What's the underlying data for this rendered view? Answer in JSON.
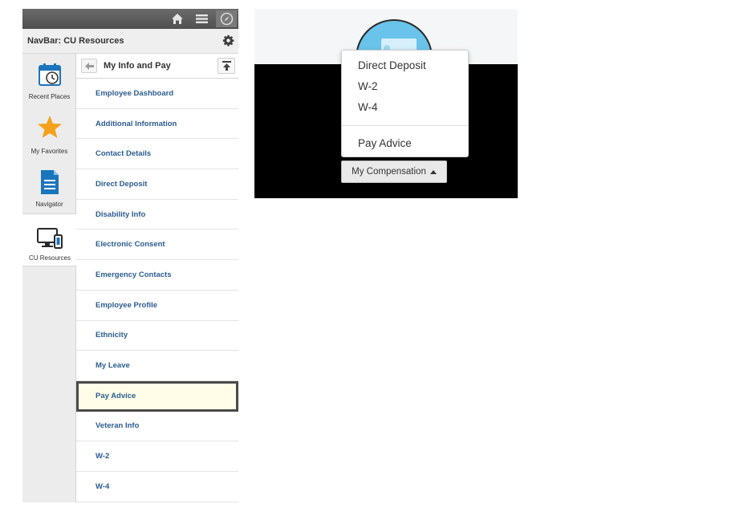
{
  "navbar": {
    "title": "NavBar: CU Resources",
    "rail": [
      {
        "label": "Recent Places",
        "icon": "calendar-clock-icon"
      },
      {
        "label": "My Favorites",
        "icon": "star-icon"
      },
      {
        "label": "Navigator",
        "icon": "document-icon"
      },
      {
        "label": "CU Resources",
        "icon": "devices-icon"
      }
    ],
    "list_title": "My Info and Pay",
    "items": [
      "Employee Dashboard",
      "Additional Information",
      "Contact Details",
      "Direct Deposit",
      "Disability Info",
      "Electronic Consent",
      "Emergency Contacts",
      "Employee Profile",
      "Ethnicity",
      "My Leave",
      "Pay Advice",
      "Veteran Info",
      "W-2",
      "W-4"
    ],
    "selected_item": "Pay Advice"
  },
  "compensation": {
    "menu": [
      "Direct Deposit",
      "W-2",
      "W-4",
      "Pay Advice"
    ],
    "button_label": "My Compensation"
  },
  "colors": {
    "link": "#2a5c8f",
    "star": "#f4a21c",
    "accent_blue": "#1b75bc",
    "tile_circle": "#69c3ea"
  }
}
